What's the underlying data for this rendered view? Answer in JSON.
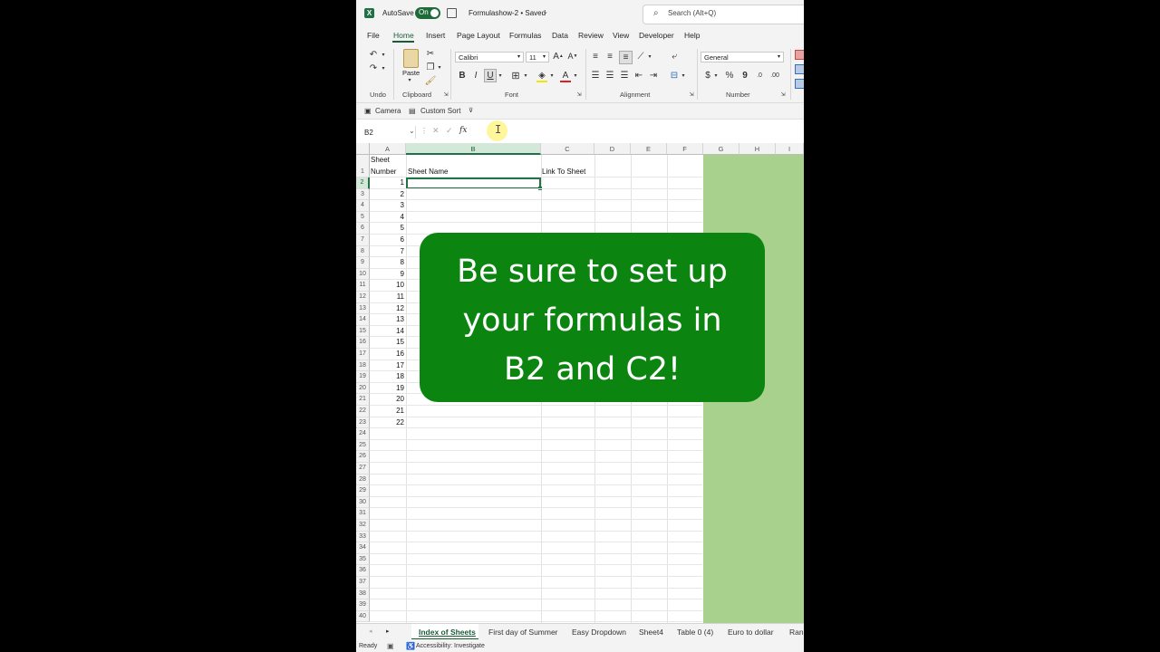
{
  "titlebar": {
    "autosave_label": "AutoSave",
    "autosave_state": "On",
    "doc_title": "Formulashow-2 • Saved",
    "search_placeholder": "Search (Alt+Q)"
  },
  "tabs": [
    "File",
    "Home",
    "Insert",
    "Page Layout",
    "Formulas",
    "Data",
    "Review",
    "View",
    "Developer",
    "Help"
  ],
  "ribbon": {
    "groups": {
      "undo": "Undo",
      "clipboard": "Clipboard",
      "font": "Font",
      "alignment": "Alignment",
      "number": "Number"
    },
    "paste_label": "Paste",
    "font_name": "Calibri",
    "font_size": "11",
    "number_format": "General"
  },
  "qat": {
    "camera": "Camera",
    "custom_sort": "Custom Sort"
  },
  "formula_bar": {
    "name_box": "B2",
    "fx": "fx",
    "value": ""
  },
  "grid": {
    "columns": [
      "A",
      "B",
      "C",
      "D",
      "E",
      "F",
      "G",
      "H",
      "I"
    ],
    "rows": [
      "1",
      "2",
      "3",
      "4",
      "5",
      "6",
      "7",
      "8",
      "9",
      "10",
      "11",
      "12",
      "13",
      "14",
      "15",
      "16",
      "17",
      "18",
      "19",
      "20",
      "21",
      "22",
      "23",
      "24",
      "25",
      "26",
      "27",
      "28",
      "29",
      "30",
      "31",
      "32",
      "33",
      "34",
      "35",
      "36",
      "37",
      "38",
      "39",
      "40"
    ],
    "a1_line1": "Sheet",
    "a1_line2": "Number",
    "b1": "Sheet Name",
    "c1": "Link To Sheet",
    "sheet_numbers": [
      "1",
      "2",
      "3",
      "4",
      "5",
      "6",
      "7",
      "8",
      "9",
      "10",
      "11",
      "12",
      "13",
      "14",
      "15",
      "16",
      "17",
      "18",
      "19",
      "20",
      "21",
      "22"
    ],
    "highlight_color": "#a9d18e"
  },
  "sheet_tabs": [
    "Index of Sheets",
    "First day of Summer",
    "Easy Dropdown",
    "Sheet4",
    "Table 0 (4)",
    "Euro to dollar",
    "Rand"
  ],
  "status": {
    "ready": "Ready",
    "accessibility": "Accessibility: Investigate"
  },
  "overlay": {
    "lines": [
      "Be sure to set up",
      "your formulas in",
      "B2 and C2!"
    ],
    "color": "#0c8510"
  },
  "accent_color": "#185c37"
}
